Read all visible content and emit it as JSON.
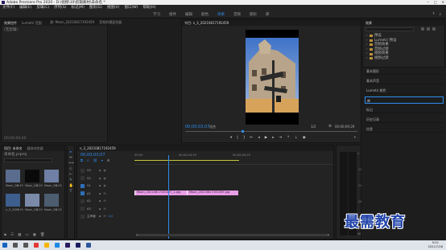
{
  "window": {
    "title": "Adobe Premiere Pro 2020 - D:\\视频\\10\\剪辑素材\\未命名 *",
    "controls": [
      "─",
      "□",
      "✕"
    ]
  },
  "menu": [
    "文件(F)",
    "编辑(E)",
    "剪辑(C)",
    "序列(S)",
    "标记(M)",
    "图形(G)",
    "视图(V)",
    "窗口(W)",
    "帮助(H)"
  ],
  "workspaces": {
    "tabs": [
      "学习",
      "组件",
      "编辑",
      "颜色",
      "效果",
      "音频",
      "图形",
      "库"
    ],
    "active_index": 4
  },
  "source_panel": {
    "tabs": [
      "效果控件",
      "Lumetri 范围",
      "源: Moon_20210817192459",
      "音频剪辑混合器"
    ],
    "subtab": "(无剪辑)",
    "timecode": "00;00;00;00"
  },
  "program_monitor": {
    "tab": "节目: n_3_20210817192459",
    "timecode": "00;00;03;07",
    "fit": "适合",
    "quality": "1/2",
    "duration": "00;00;09;29"
  },
  "project_panel": {
    "tabs": [
      "项目: 未命名",
      "媒体浏览器"
    ],
    "project_name": "未命名.prproj",
    "items": [
      {
        "label": "Moon_20210817",
        "length": "4:29"
      },
      {
        "label": "Moon_20210817",
        "length": "4:29"
      },
      {
        "label": "Moon_20210817",
        "length": "4:29"
      },
      {
        "label": "n_3_20210817",
        "length": "9:29"
      },
      {
        "label": "Moon_20210817",
        "length": "4:29"
      },
      {
        "label": "Moon_20210817",
        "length": "4:29"
      }
    ]
  },
  "timeline": {
    "tab": "n_3_20210817192459",
    "timecode": "00;00;03;07",
    "ruler": [
      "00;00",
      "00;00;04;29",
      "00;00;09;29"
    ],
    "tracks": [
      "V3",
      "V2",
      "V1",
      "A1",
      "A2",
      "A3",
      "主声道"
    ],
    "master_value": "0.0",
    "clips": [
      {
        "label": "Moon_20210817192457_1.jpg"
      },
      {
        "label": "Moon_20210817192459.jpg"
      }
    ],
    "scrollbar": [
      "◂",
      "▸"
    ]
  },
  "effects_panel": {
    "title": "效果",
    "folders": [
      "预设",
      "Lumetri 预设",
      "音频效果",
      "音频过渡",
      "视频效果",
      "视频过渡"
    ],
    "sections": [
      "基本图形",
      "基本声音",
      "Lumetri 颜色",
      "库",
      "标记",
      "历史记录",
      "信息"
    ],
    "active_section_index": 3
  },
  "tools": [
    "▸",
    "⇔",
    "⟺",
    "◇",
    "⊢",
    "✎",
    "✋",
    "T"
  ],
  "audio_meters": [
    "0",
    "-12",
    "-24",
    "-36",
    "-48",
    "dB"
  ],
  "taskbar": {
    "icons": [
      {
        "name": "start",
        "color": "#1565c0"
      },
      {
        "name": "search",
        "color": "#555555"
      },
      {
        "name": "taskview",
        "color": "#555555"
      },
      {
        "name": "chrome",
        "color": "#e53935"
      },
      {
        "name": "explorer",
        "color": "#f4b400"
      },
      {
        "name": "edge",
        "color": "#1e88e5"
      },
      {
        "name": "premiere",
        "color": "#2a1a5e"
      },
      {
        "name": "media-encoder",
        "color": "#1a1a5e"
      },
      {
        "name": "word",
        "color": "#2b579a"
      }
    ],
    "clock": "9:52",
    "date": "2021/7/28"
  },
  "watermark": {
    "text": "最需教育",
    "color": "#2244aa"
  },
  "colors": {
    "accent": "#2d8ceb",
    "clip": "#e79ee6",
    "playhead": "#2d8ceb"
  }
}
